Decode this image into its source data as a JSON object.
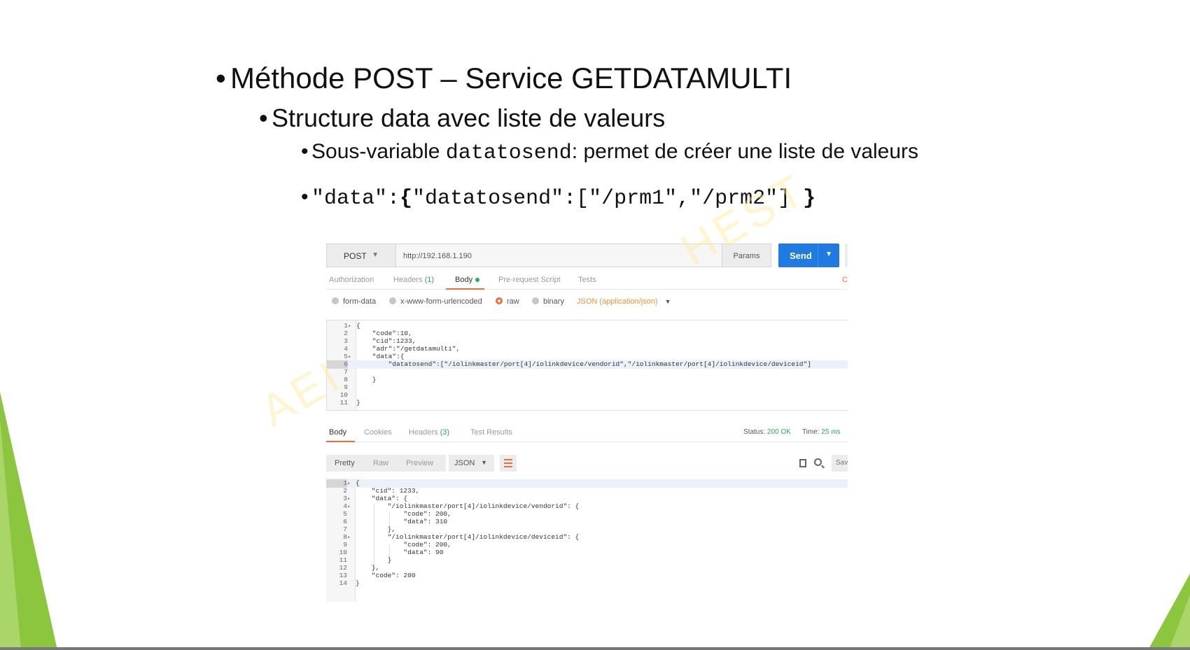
{
  "slide": {
    "bullets": {
      "l1": "Méthode POST – Service GETDATAMULTI",
      "l2": "Structure data avec liste de valeurs",
      "l3_pre": "Sous-variable ",
      "l3_mono": "datatosend",
      "l3_post": ": permet de créer une liste de valeurs",
      "l4_a": "\"data\":",
      "l4_b": "{",
      "l4_c": "\"datatosend\":[\"/prm1\",\"/prm2\"] ",
      "l4_d": "}"
    },
    "watermark_left": "AEI",
    "watermark_right": "HEST"
  },
  "postman": {
    "method": "POST",
    "url": "http://192.168.1.190",
    "params_label": "Params",
    "send_label": "Send",
    "request_tabs": {
      "authorization": "Authorization",
      "headers": "Headers",
      "headers_count": "(1)",
      "body": "Body",
      "prerequest": "Pre-request Script",
      "tests": "Tests",
      "edge": "C"
    },
    "body_types": {
      "form_data": "form-data",
      "urlencoded": "x-www-form-urlencoded",
      "raw": "raw",
      "binary": "binary",
      "json_type": "JSON (application/json)"
    },
    "request_body": [
      {
        "n": "1",
        "fold": "▾",
        "code": "{"
      },
      {
        "n": "2",
        "fold": "",
        "code": "    \"code\":10,"
      },
      {
        "n": "3",
        "fold": "",
        "code": "    \"cid\":1233,"
      },
      {
        "n": "4",
        "fold": "",
        "code": "    \"adr\":\"/getdatamulti\","
      },
      {
        "n": "5",
        "fold": "▾",
        "code": "    \"data\":{"
      },
      {
        "n": "6",
        "fold": "",
        "code": "        \"datatosend\":[\"/iolinkmaster/port[4]/iolinkdevice/vendorid\",\"/iolinkmaster/port[4]/iolinkdevice/deviceid\"]"
      },
      {
        "n": "7",
        "fold": "",
        "code": ""
      },
      {
        "n": "8",
        "fold": "",
        "code": "    }"
      },
      {
        "n": "9",
        "fold": "",
        "code": ""
      },
      {
        "n": "10",
        "fold": "",
        "code": ""
      },
      {
        "n": "11",
        "fold": "",
        "code": "}"
      }
    ],
    "response_tabs": {
      "body": "Body",
      "cookies": "Cookies",
      "headers": "Headers",
      "headers_count": "(3)",
      "test_results": "Test Results"
    },
    "status": {
      "status_label": "Status:",
      "status_value": "200 OK",
      "time_label": "Time:",
      "time_value": "25 ms"
    },
    "format_tabs": {
      "pretty": "Pretty",
      "raw": "Raw",
      "preview": "Preview",
      "json": "JSON",
      "save": "Sav"
    },
    "response_body": [
      {
        "n": "1",
        "fold": "▾",
        "code": "{"
      },
      {
        "n": "2",
        "fold": "",
        "code": "    \"cid\": 1233,"
      },
      {
        "n": "3",
        "fold": "▾",
        "code": "    \"data\": {"
      },
      {
        "n": "4",
        "fold": "▾",
        "code": "        \"/iolinkmaster/port[4]/iolinkdevice/vendorid\": {"
      },
      {
        "n": "5",
        "fold": "",
        "code": "            \"code\": 200,"
      },
      {
        "n": "6",
        "fold": "",
        "code": "            \"data\": 310"
      },
      {
        "n": "7",
        "fold": "",
        "code": "        },"
      },
      {
        "n": "8",
        "fold": "▾",
        "code": "        \"/iolinkmaster/port[4]/iolinkdevice/deviceid\": {"
      },
      {
        "n": "9",
        "fold": "",
        "code": "            \"code\": 200,"
      },
      {
        "n": "10",
        "fold": "",
        "code": "            \"data\": 90"
      },
      {
        "n": "11",
        "fold": "",
        "code": "        }"
      },
      {
        "n": "12",
        "fold": "",
        "code": "    },"
      },
      {
        "n": "13",
        "fold": "",
        "code": "    \"code\": 200"
      },
      {
        "n": "14",
        "fold": "",
        "code": "}"
      }
    ]
  },
  "colors": {
    "send_blue": "#1f7be0",
    "accent_orange": "#f26b3a",
    "ok_green": "#2bab5a",
    "deco_green": "#8cc63f"
  }
}
